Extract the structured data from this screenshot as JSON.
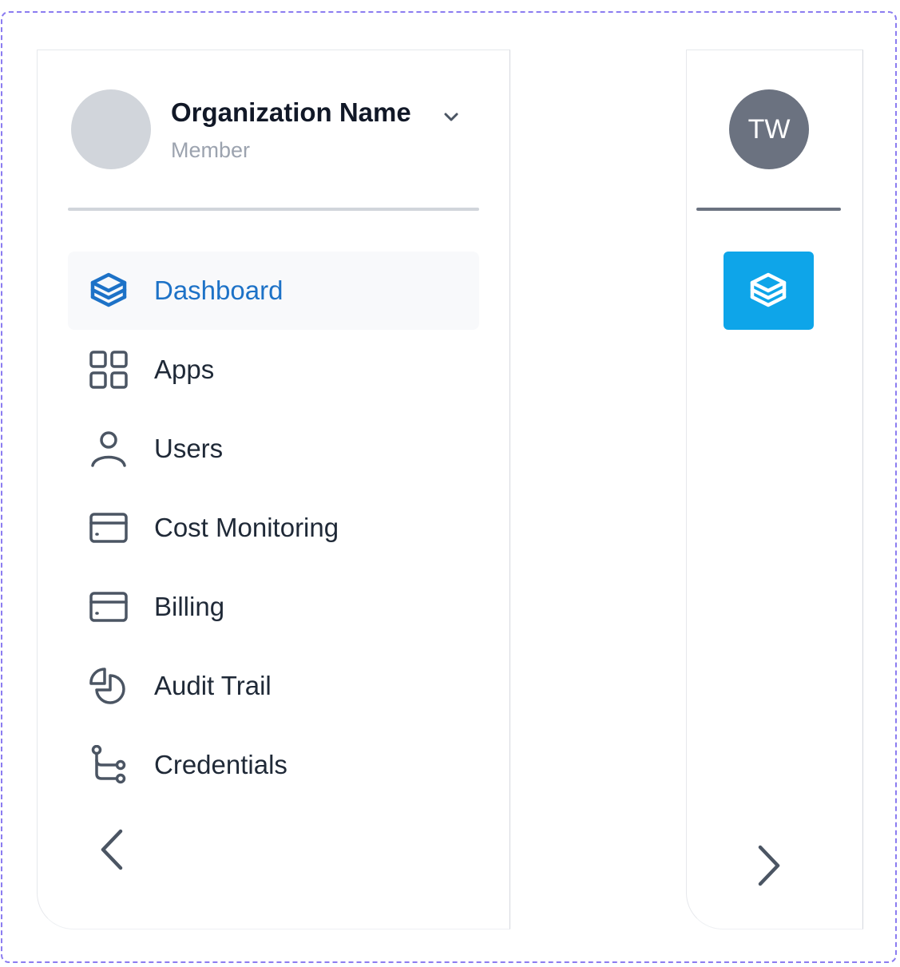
{
  "org": {
    "name": "Organization Name",
    "role": "Member",
    "avatar_color": "#d1d5db"
  },
  "nav": [
    {
      "label": "Dashboard",
      "icon": "stack-layers-icon",
      "active": true
    },
    {
      "label": "Apps",
      "icon": "grid-icon"
    },
    {
      "label": "Users",
      "icon": "user-icon"
    },
    {
      "label": "Cost Monitoring",
      "icon": "credit-card-icon"
    },
    {
      "label": "Billing",
      "icon": "credit-card-icon"
    },
    {
      "label": "Audit Trail",
      "icon": "pie-chart-icon"
    },
    {
      "label": "Credentials",
      "icon": "git-branch-icon"
    }
  ],
  "collapse_icon": "chevron-left-icon",
  "mini": {
    "initials": "TW",
    "avatar_color": "#6b7280",
    "active_color": "#0ea5e9",
    "active_icon": "stack-layers-icon",
    "expand_icon": "chevron-right-icon"
  },
  "colors": {
    "active_text": "#1d72c7",
    "text": "#1f2937",
    "muted": "#9ca3af",
    "frame_dash": "#8b7cf0"
  }
}
